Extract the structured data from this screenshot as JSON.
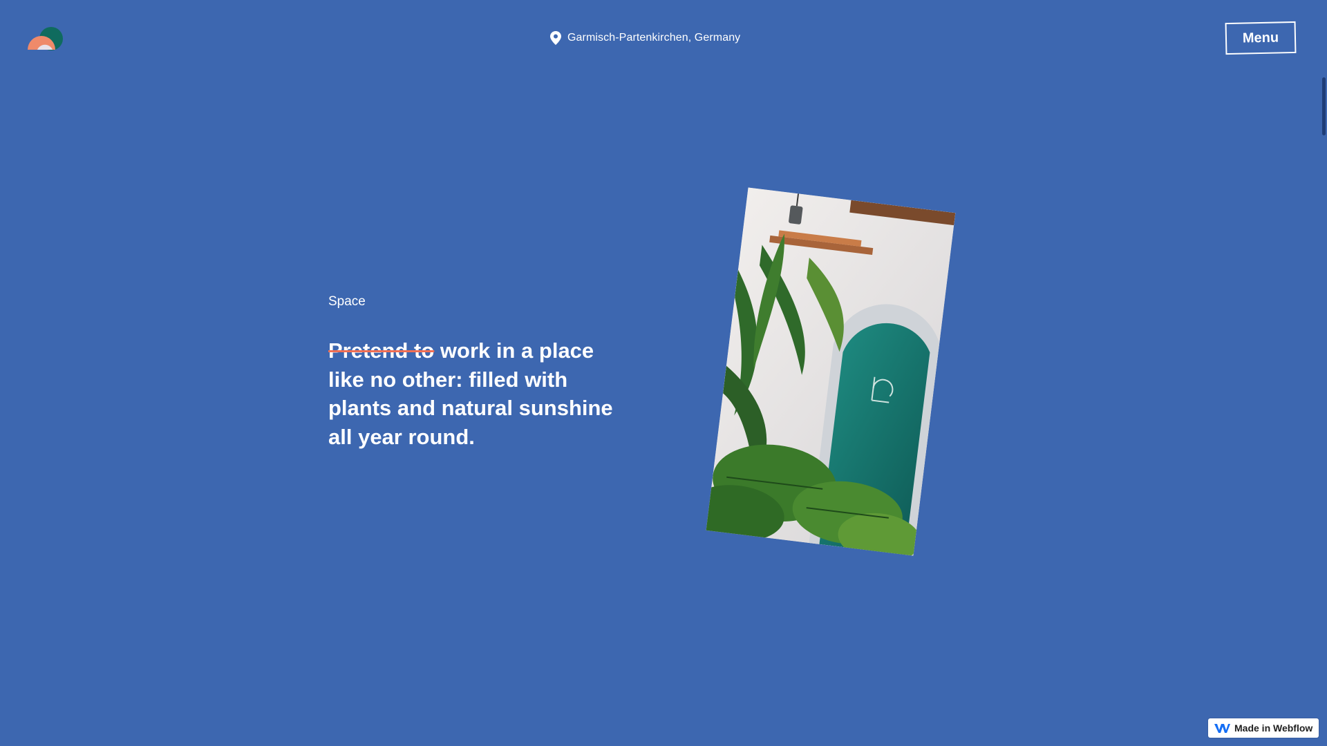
{
  "header": {
    "location": "Garmisch-Partenkirchen, Germany",
    "menu_label": "Menu"
  },
  "hero": {
    "section_label": "Space",
    "headline_struck": "Pretend to",
    "headline_rest": " work in a place like no other: filled with plants and natural sunshine all year round."
  },
  "badge": {
    "label": "Made in Webflow"
  },
  "icons": {
    "logo": "brand-logo",
    "location": "map-pin-icon",
    "badge": "webflow-logo-icon"
  },
  "colors": {
    "background": "#3d67b0",
    "strike": "#f06f55",
    "logo_teal": "#0f6b5e",
    "logo_orange": "#ef8a6a",
    "logo_light": "#e8e2ea"
  }
}
